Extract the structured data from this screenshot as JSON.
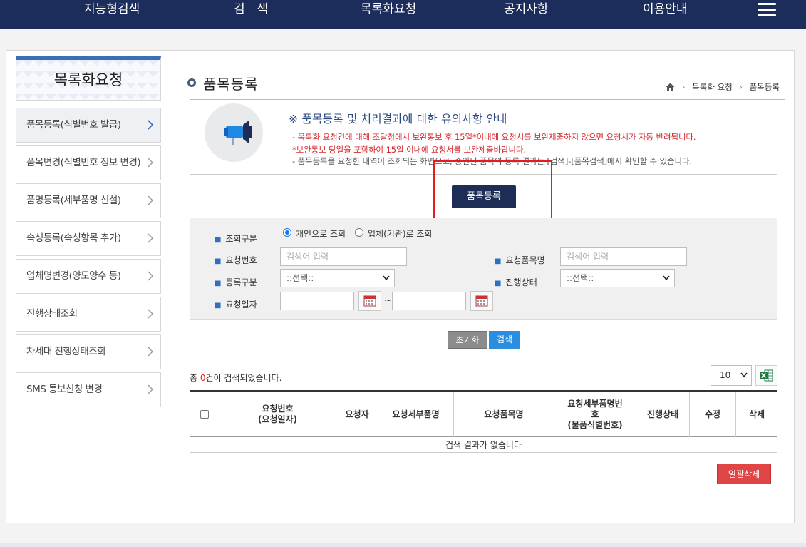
{
  "topnav": {
    "items": [
      "지능형검색",
      "검　색",
      "목록화요청",
      "공지사항",
      "이용안내"
    ]
  },
  "sidebar": {
    "title": "목록화요청",
    "items": [
      {
        "label": "품목등록(식별번호 발급)",
        "active": true
      },
      {
        "label": "품목변경(식별번호 정보 변경)",
        "active": false
      },
      {
        "label": "품명등록(세부품명 신설)",
        "active": false
      },
      {
        "label": "속성등록(속성항목 추가)",
        "active": false
      },
      {
        "label": "업체명변경(양도양수 등)",
        "active": false
      },
      {
        "label": "진행상태조회",
        "active": false
      },
      {
        "label": "차세대 진행상태조회",
        "active": false
      },
      {
        "label": "SMS 통보신청 변경",
        "active": false
      }
    ]
  },
  "page": {
    "title": "품목등록",
    "breadcrumb": [
      "목록화 요청",
      "품목등록"
    ]
  },
  "notice": {
    "heading": "※ 품목등록 및 처리결과에 대한 유의사항 안내",
    "lines": [
      {
        "text": "- 목록화 요청건에 대해 조달청에서 보완통보 후 15일*이내에 요청서를 보완제출하지 않으면 요청서가 자동 반려됩니다.",
        "color": "red"
      },
      {
        "text": "*보완통보 당일을 포함하여 15일 이내에 요청서를 보완제출바랍니다.",
        "color": "red"
      },
      {
        "text": "- 품목등록을 요청한 내역이 조회되는 화면으로, 승인된 품목의 등록 결과는 [검색]-[품목검색]에서 확인할 수 있습니다.",
        "color": "gray"
      }
    ]
  },
  "register_button": "품목등록",
  "search": {
    "query_type_label": "조회구분",
    "radio_personal": "개인으로 조회",
    "radio_company": "업체(기관)로 조회",
    "request_no_label": "요청번호",
    "request_no_placeholder": "검색어 입력",
    "request_item_name_label": "요청품목명",
    "request_item_name_placeholder": "검색어 입력",
    "reg_type_label": "등록구분",
    "reg_type_value": "::선택::",
    "status_label": "진행상태",
    "status_value": "::선택::",
    "request_date_label": "요청일자",
    "date_sep": "~",
    "reset_button": "초기화",
    "search_button": "검색"
  },
  "results": {
    "count_prefix": "총 ",
    "count": "0",
    "count_suffix": "건이 검색되었습니다.",
    "page_size": "10",
    "no_result": "검색 결과가 없습니다"
  },
  "table": {
    "headers": [
      {
        "l1": "요청번호",
        "l2": "(요청일자)"
      },
      {
        "l1": "요청자",
        "l2": ""
      },
      {
        "l1": "요청세부품명",
        "l2": ""
      },
      {
        "l1": "요청품목명",
        "l2": ""
      },
      {
        "l1": "요청세부품명번",
        "l2": "호",
        "l3": "(물품식별번호)"
      },
      {
        "l1": "진행상태",
        "l2": ""
      },
      {
        "l1": "수정",
        "l2": ""
      },
      {
        "l1": "삭제",
        "l2": ""
      }
    ]
  },
  "bulk_delete_button": "일괄삭제",
  "colors": {
    "nav_bg": "#1c2d5c",
    "accent_blue": "#2a8ee0",
    "warning_red": "#d7262b",
    "register_btn": "#1e2d55",
    "delete_btn": "#e04545"
  }
}
